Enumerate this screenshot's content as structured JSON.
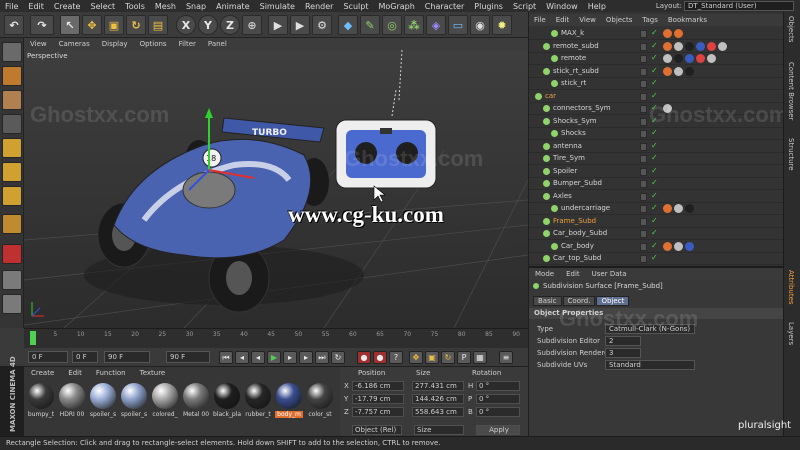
{
  "app": {
    "menu": [
      "File",
      "Edit",
      "Create",
      "Select",
      "Tools",
      "Mesh",
      "Snap",
      "Animate",
      "Simulate",
      "Render",
      "Sculpt",
      "MoGraph",
      "Character",
      "Plugins",
      "Script",
      "Window",
      "Help"
    ],
    "layout_label": "Layout:",
    "layout_value": "DT_Standard (User)"
  },
  "toolbar": {
    "axis_labels": [
      "X",
      "Y",
      "Z"
    ]
  },
  "viewport": {
    "menu": [
      "View",
      "Cameras",
      "Display",
      "Options",
      "Filter",
      "Panel"
    ],
    "camera_label": "Perspective",
    "car_decal": "TURBO",
    "car_number": "18"
  },
  "timeline": {
    "ticks": [
      "0",
      "5",
      "10",
      "15",
      "20",
      "25",
      "30",
      "35",
      "40",
      "45",
      "50",
      "55",
      "60",
      "65",
      "70",
      "75",
      "80",
      "85",
      "90"
    ],
    "start_frame": "0 F",
    "current_frame": "0 F",
    "end_frame": "90 F",
    "end_frame_2": "90 F"
  },
  "materials": {
    "menu": [
      "Create",
      "Edit",
      "Function",
      "Texture"
    ],
    "items": [
      {
        "name": "bumpy_t",
        "color": "#3a3a3a"
      },
      {
        "name": "HDRI 00",
        "color": "#8a8a8a"
      },
      {
        "name": "spoiler_s",
        "color": "#9cb0d8"
      },
      {
        "name": "spoiler_s",
        "color": "#8fa3cc"
      },
      {
        "name": "colored_",
        "color": "#a8a8a8"
      },
      {
        "name": "Metal 00",
        "color": "#7a7a7a"
      },
      {
        "name": "black_pla",
        "color": "#1e1e1e"
      },
      {
        "name": "rubber_t",
        "color": "#262626"
      },
      {
        "name": "body_m",
        "color": "#3a4e90"
      },
      {
        "name": "color_st",
        "color": "#444444"
      }
    ]
  },
  "coordinates": {
    "headers": [
      "Position",
      "Size",
      "Rotation"
    ],
    "rows": [
      {
        "axis": "X",
        "pos": "-6.186 cm",
        "size": "277.431 cm",
        "rot_axis": "H",
        "rot": "0 °"
      },
      {
        "axis": "Y",
        "pos": "-17.79 cm",
        "size": "144.426 cm",
        "rot_axis": "P",
        "rot": "0 °"
      },
      {
        "axis": "Z",
        "pos": "-7.757 cm",
        "size": "558.643 cm",
        "rot_axis": "B",
        "rot": "0 °"
      }
    ],
    "mode_select": "Object (Rel)",
    "size_select": "Size",
    "apply_label": "Apply"
  },
  "objects": {
    "menu": [
      "File",
      "Edit",
      "View",
      "Objects",
      "Tags",
      "Bookmarks"
    ],
    "rows": [
      {
        "name": "MAX_k",
        "indent": 2,
        "highlight": false,
        "tags": [
          "#e07030",
          "#e07030"
        ]
      },
      {
        "name": "remote_subd",
        "indent": 1,
        "highlight": false,
        "tags": [
          "#e07030",
          "#c0c0c0",
          "#202020",
          "#3a5cc0",
          "#e04040",
          "#c0c0c0"
        ]
      },
      {
        "name": "remote",
        "indent": 2,
        "highlight": false,
        "tags": [
          "#c0c0c0",
          "#202020",
          "#3a5cc0",
          "#e04040",
          "#c0c0c0"
        ]
      },
      {
        "name": "stick_rt_subd",
        "indent": 1,
        "highlight": false,
        "tags": [
          "#e07030",
          "#c0c0c0",
          "#202020"
        ]
      },
      {
        "name": "stick_rt",
        "indent": 2,
        "highlight": false,
        "tags": []
      },
      {
        "name": "car",
        "indent": 0,
        "highlight": true,
        "tags": []
      },
      {
        "name": "connectors_Sym",
        "indent": 1,
        "highlight": false,
        "tags": [
          "#c0c0c0"
        ]
      },
      {
        "name": "Shocks_Sym",
        "indent": 1,
        "highlight": false,
        "tags": []
      },
      {
        "name": "Shocks",
        "indent": 2,
        "highlight": false,
        "tags": []
      },
      {
        "name": "antenna",
        "indent": 1,
        "highlight": false,
        "tags": []
      },
      {
        "name": "Tire_Sym",
        "indent": 1,
        "highlight": false,
        "tags": []
      },
      {
        "name": "Spoiler",
        "indent": 1,
        "highlight": false,
        "tags": []
      },
      {
        "name": "Bumper_Subd",
        "indent": 1,
        "highlight": false,
        "tags": []
      },
      {
        "name": "Axles",
        "indent": 1,
        "highlight": false,
        "tags": []
      },
      {
        "name": "undercarriage",
        "indent": 2,
        "highlight": false,
        "tags": [
          "#e07030",
          "#c0c0c0",
          "#202020"
        ]
      },
      {
        "name": "Frame_Subd",
        "indent": 1,
        "highlight": true,
        "tags": []
      },
      {
        "name": "Car_body_Subd",
        "indent": 1,
        "highlight": false,
        "tags": []
      },
      {
        "name": "Car_body",
        "indent": 2,
        "highlight": false,
        "tags": [
          "#e07030",
          "#c0c0c0",
          "#3a5cc0"
        ]
      },
      {
        "name": "Car_top_Subd",
        "indent": 1,
        "highlight": false,
        "tags": []
      }
    ]
  },
  "attributes": {
    "menu": [
      "Mode",
      "Edit",
      "User Data"
    ],
    "title": "Subdivision Surface [Frame_Subd]",
    "tabs": [
      "Basic",
      "Coord.",
      "Object"
    ],
    "active_tab": "Object",
    "section": "Object Properties",
    "rows": [
      {
        "label": "Type",
        "value": "Catmull-Clark (N-Gons)"
      },
      {
        "label": "Subdivision Editor",
        "value": "2"
      },
      {
        "label": "Subdivision Renderer",
        "value": "3"
      },
      {
        "label": "Subdivide UVs",
        "value": "Standard"
      }
    ]
  },
  "right_tabs": [
    "Objects",
    "Content Browser",
    "Structure",
    "Attributes",
    "Layers"
  ],
  "branding": {
    "maxon": "MAXON CINEMA 4D",
    "watermark": "Ghostxx.com",
    "cgku": "www.cg-ku.com",
    "pluralsight": "pluralsight"
  },
  "status_text": "Rectangle Selection: Click and drag to rectangle-select elements. Hold down SHIFT to add to the selection, CTRL to remove."
}
